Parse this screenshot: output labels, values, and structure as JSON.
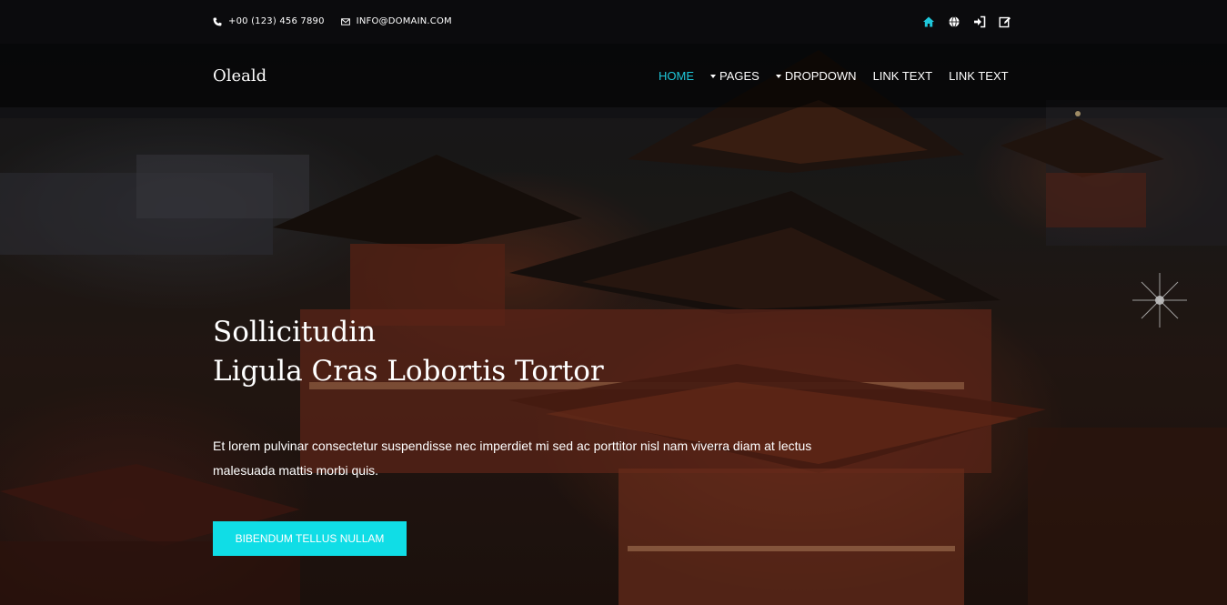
{
  "topbar": {
    "phone": "+00 (123) 456 7890",
    "email": "INFO@DOMAIN.COM",
    "phone_icon": "phone-icon",
    "email_icon": "envelope-icon",
    "links": [
      {
        "icon": "home-icon"
      },
      {
        "icon": "globe-icon"
      },
      {
        "icon": "sign-in-icon"
      },
      {
        "icon": "edit-icon"
      }
    ]
  },
  "navbar": {
    "brand": "Oleald",
    "items": [
      {
        "label": "HOME",
        "active": true
      },
      {
        "label": "PAGES",
        "dropdown": true
      },
      {
        "label": "DROPDOWN",
        "dropdown": true
      },
      {
        "label": "LINK TEXT"
      },
      {
        "label": "LINK TEXT"
      }
    ]
  },
  "hero": {
    "title_line1": "Sollicitudin",
    "title_line2": "Ligula Cras Lobortis Tortor",
    "text": "Et lorem pulvinar consectetur suspendisse nec imperdiet mi sed ac porttitor nisl nam viverra diam at lectus malesuada mattis morbi quis.",
    "button": "BIBENDUM TELLUS NULLAM"
  },
  "colors": {
    "accent": "#1fc8db",
    "button": "#10dde6",
    "text": "#ffffff"
  }
}
